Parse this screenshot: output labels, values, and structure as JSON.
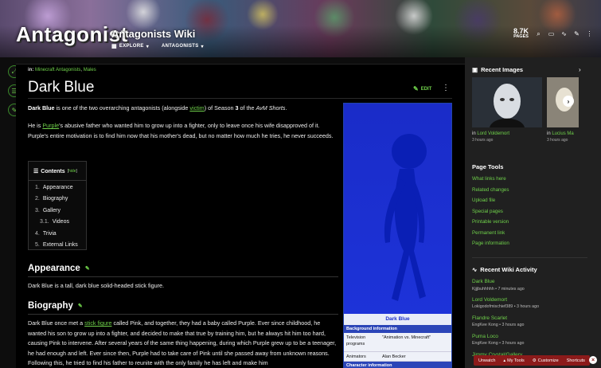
{
  "header": {
    "logo_text": "Antagonist",
    "wiki_name": "Antagonists Wiki",
    "nav": [
      {
        "label": "EXPLORE",
        "icon": "explore-icon"
      },
      {
        "label": "ANTAGONISTS",
        "icon": "chevron-down-icon"
      }
    ],
    "pages_count": "8.7K",
    "pages_label": "PAGES",
    "icons": [
      "search-icon",
      "display-icon",
      "activity-icon",
      "edit-icon",
      "more-icon"
    ]
  },
  "rail": [
    "expand-icon",
    "toc-icon",
    "edit-icon"
  ],
  "article": {
    "categories_label": "in:",
    "categories": [
      "Minecraft Antagonists",
      "Males"
    ],
    "title": "Dark Blue",
    "edit_label": "EDIT",
    "intro": {
      "name": "Dark Blue",
      "t1": " is one of the two overarching antagonists (alongside ",
      "link1": "victim",
      "t2": ") of Season ",
      "season": "3",
      "t3": " of the ",
      "series": "AvM Shorts",
      "t4": "."
    },
    "para2": {
      "t1": "He is ",
      "link1": "Purple",
      "t2": "'s abusive father who wanted him to grow up into a fighter, only to leave once his wife disapproved of it. Purple's entire motivation is to find him now that his mother's dead, but no matter how much he tries, he never succeeds."
    },
    "toc": {
      "title": "Contents",
      "hide_label": "hide",
      "items": [
        {
          "num": "1.",
          "label": "Appearance"
        },
        {
          "num": "2.",
          "label": "Biography"
        },
        {
          "num": "3.",
          "label": "Gallery"
        },
        {
          "num": "3.1.",
          "label": "Videos"
        },
        {
          "num": "4.",
          "label": "Trivia"
        },
        {
          "num": "5.",
          "label": "External Links"
        }
      ]
    },
    "appearance_heading": "Appearance",
    "appearance_text": "Dark Blue is a tall, dark blue solid-headed stick figure.",
    "biography_heading": "Biography",
    "biography": {
      "t1": "Dark Blue once met a ",
      "link1": "stick figure",
      "t2": " called Pink, and together, they had a baby called Purple. Ever since childhood, he wanted his son to grow up into a fighter, and decided to make that true by training him, but he always hit him too hard, causing Pink to intervene. After several years of the same thing happening, during which Purple grew up to be a teenager, he had enough and left. Ever since then, Purple had to take care of Pink until she passed away from unknown reasons. Following this, he tried to find his father to reunite with the only family he has left and make him"
    }
  },
  "infobox": {
    "caption": "Dark Blue",
    "section1": "Background information",
    "rows": [
      {
        "k": "Television programs",
        "v": "\"Animation vs. Minecraft\""
      },
      {
        "k": "Animators",
        "v": "Alan Becker"
      }
    ],
    "section2": "Character information"
  },
  "sidebar": {
    "recent_images_title": "Recent Images",
    "images": [
      {
        "prefix": "in ",
        "link": "Lord Voldemort",
        "time": "3 hours ago"
      },
      {
        "prefix": "in ",
        "link": "Lucius Ma",
        "time": "3 hours ago"
      }
    ],
    "page_tools_title": "Page Tools",
    "tools": [
      "What links here",
      "Related changes",
      "Upload file",
      "Special pages",
      "Printable version",
      "Permanent link",
      "Page information"
    ],
    "activity_title": "Recent Wiki Activity",
    "activity": [
      {
        "title": "Dark Blue",
        "meta": "Kjjjbuhhhhh • 7 minutes ago"
      },
      {
        "title": "Lord Voldemort",
        "meta": "Lokigodofmischief389 • 3 hours ago"
      },
      {
        "title": "Flandre Scarlet",
        "meta": "EngKee Kong • 3 hours ago"
      },
      {
        "title": "Puma Loco",
        "meta": "EngKee Kong • 3 hours ago"
      },
      {
        "title": "Jimmy Crystal/Gallery",
        "meta": ""
      }
    ]
  },
  "toolbar": {
    "items": [
      "Unwatch",
      "My Tools",
      "Customize",
      "Shortcuts"
    ]
  },
  "colors": {
    "accent": "#6fd14a",
    "toolbar": "#8b1a1a",
    "infobox": "#1a2cc8"
  }
}
